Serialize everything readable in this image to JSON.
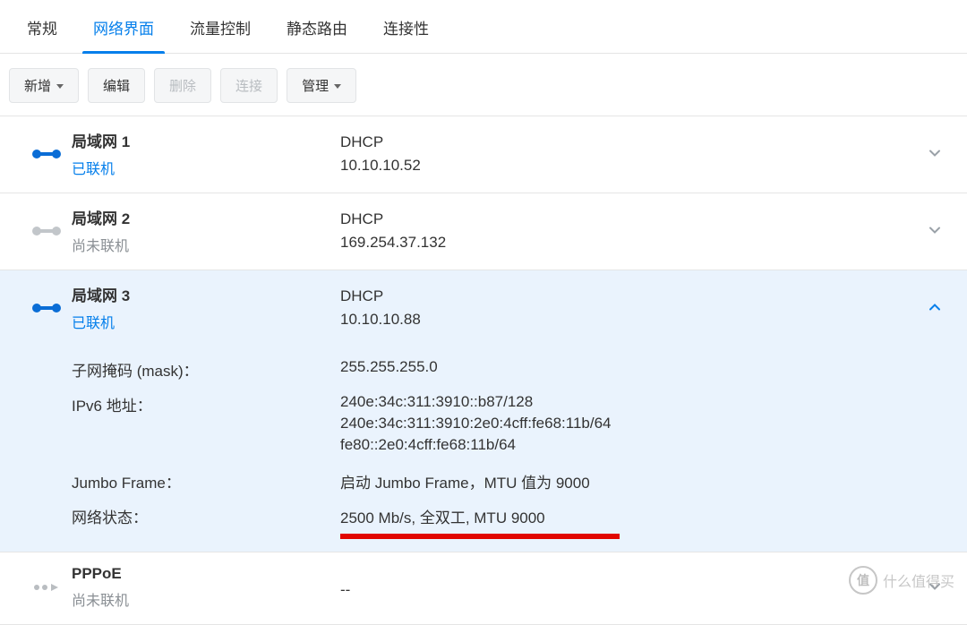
{
  "tabs": [
    "常规",
    "网络界面",
    "流量控制",
    "静态路由",
    "连接性"
  ],
  "activeTab": 1,
  "toolbar": {
    "add": "新增",
    "edit": "编辑",
    "del": "删除",
    "connect": "连接",
    "manage": "管理"
  },
  "interfaces": [
    {
      "name": "局域网 1",
      "status": "已联机",
      "statusClass": "connected",
      "type": "DHCP",
      "ip": "10.10.10.52",
      "iconType": "on",
      "expanded": false
    },
    {
      "name": "局域网 2",
      "status": "尚未联机",
      "statusClass": "disconnected",
      "type": "DHCP",
      "ip": "169.254.37.132",
      "iconType": "off",
      "expanded": false
    },
    {
      "name": "局域网 3",
      "status": "已联机",
      "statusClass": "connected",
      "type": "DHCP",
      "ip": "10.10.10.88",
      "iconType": "on",
      "expanded": true
    },
    {
      "name": "PPPoE",
      "status": "尚未联机",
      "statusClass": "disconnected",
      "type": "",
      "ip": "--",
      "iconType": "pppoe",
      "expanded": false
    }
  ],
  "details": {
    "subnet_label": "子网掩码 (mask)：",
    "subnet_value": "255.255.255.0",
    "ipv6_label": "IPv6 地址：",
    "ipv6_values": [
      "240e:34c:311:3910::b87/128",
      "240e:34c:311:3910:2e0:4cff:fe68:11b/64",
      "fe80::2e0:4cff:fe68:11b/64"
    ],
    "jumbo_label": "Jumbo Frame：",
    "jumbo_value": "启动 Jumbo Frame，MTU 值为 9000",
    "netstat_label": "网络状态：",
    "netstat_value": "2500 Mb/s, 全双工, MTU 9000"
  },
  "watermark": {
    "badge": "值",
    "text": "什么值得买"
  }
}
